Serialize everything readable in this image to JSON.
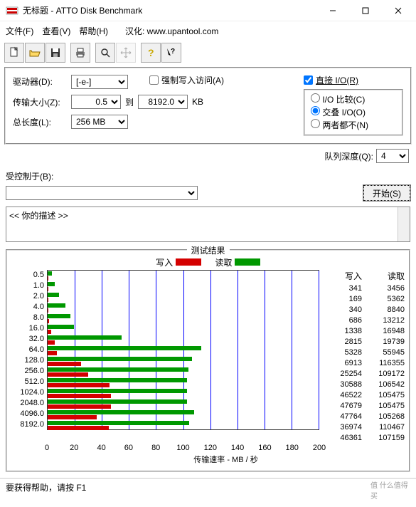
{
  "window": {
    "title": "无标题 - ATTO Disk Benchmark"
  },
  "menu": {
    "file": "文件(F)",
    "view": "查看(V)",
    "help": "帮助(H)",
    "han": "汉化: www.upantool.com"
  },
  "labels": {
    "drive": "驱动器(D):",
    "driveVal": "[-e-]",
    "size": "传输大小(Z):",
    "sizeFrom": "0.5",
    "to": "到",
    "sizeTo": "8192.0",
    "kb": "KB",
    "len": "总长度(L):",
    "lenVal": "256 MB",
    "force": "强制写入访问(A)",
    "direct": "直接 I/O(R)",
    "r1": "I/O 比较(C)",
    "r2": "交叠 I/O(O)",
    "r3": "两者都不(N)",
    "queue": "队列深度(Q):",
    "queueVal": "4",
    "controlled": "受控制于(B):",
    "start": "开始(S)",
    "desc": "<<   你的描述   >>",
    "resultsTitle": "测试结果",
    "legendW": "写入",
    "legendR": "读取",
    "xaxis": "传输速率 - MB / 秒",
    "writeCol": "写入",
    "readCol": "读取",
    "status": "要获得帮助，请按 F1"
  },
  "chart_data": {
    "type": "bar",
    "xlabel": "传输速率 - MB / 秒",
    "xlim": [
      0,
      200
    ],
    "xticks": [
      0,
      20,
      40,
      60,
      80,
      100,
      120,
      140,
      160,
      180,
      200
    ],
    "categories": [
      "0.5",
      "1.0",
      "2.0",
      "4.0",
      "8.0",
      "16.0",
      "32.0",
      "64.0",
      "128.0",
      "256.0",
      "512.0",
      "1024.0",
      "2048.0",
      "4096.0",
      "8192.0"
    ],
    "series": [
      {
        "name": "写入",
        "color": "#d40000",
        "values": [
          0.33,
          0.17,
          0.33,
          0.67,
          1.31,
          2.75,
          5.2,
          6.75,
          24.66,
          29.87,
          45.43,
          46.56,
          46.65,
          36.11,
          45.27
        ]
      },
      {
        "name": "读取",
        "color": "#009800",
        "values": [
          3.38,
          5.24,
          8.63,
          12.9,
          16.55,
          19.28,
          54.63,
          113.63,
          106.61,
          104.04,
          103.0,
          103.0,
          102.8,
          107.88,
          104.65
        ]
      }
    ],
    "raw": [
      {
        "write": 341,
        "read": 3456
      },
      {
        "write": 169,
        "read": 5362
      },
      {
        "write": 340,
        "read": 8840
      },
      {
        "write": 686,
        "read": 13212
      },
      {
        "write": 1338,
        "read": 16948
      },
      {
        "write": 2815,
        "read": 19739
      },
      {
        "write": 5328,
        "read": 55945
      },
      {
        "write": 6913,
        "read": 116355
      },
      {
        "write": 25254,
        "read": 109172
      },
      {
        "write": 30588,
        "read": 106542
      },
      {
        "write": 46522,
        "read": 105475
      },
      {
        "write": 47679,
        "read": 105475
      },
      {
        "write": 47764,
        "read": 105268
      },
      {
        "write": 36974,
        "read": 110467
      },
      {
        "write": 46361,
        "read": 107159
      }
    ]
  }
}
